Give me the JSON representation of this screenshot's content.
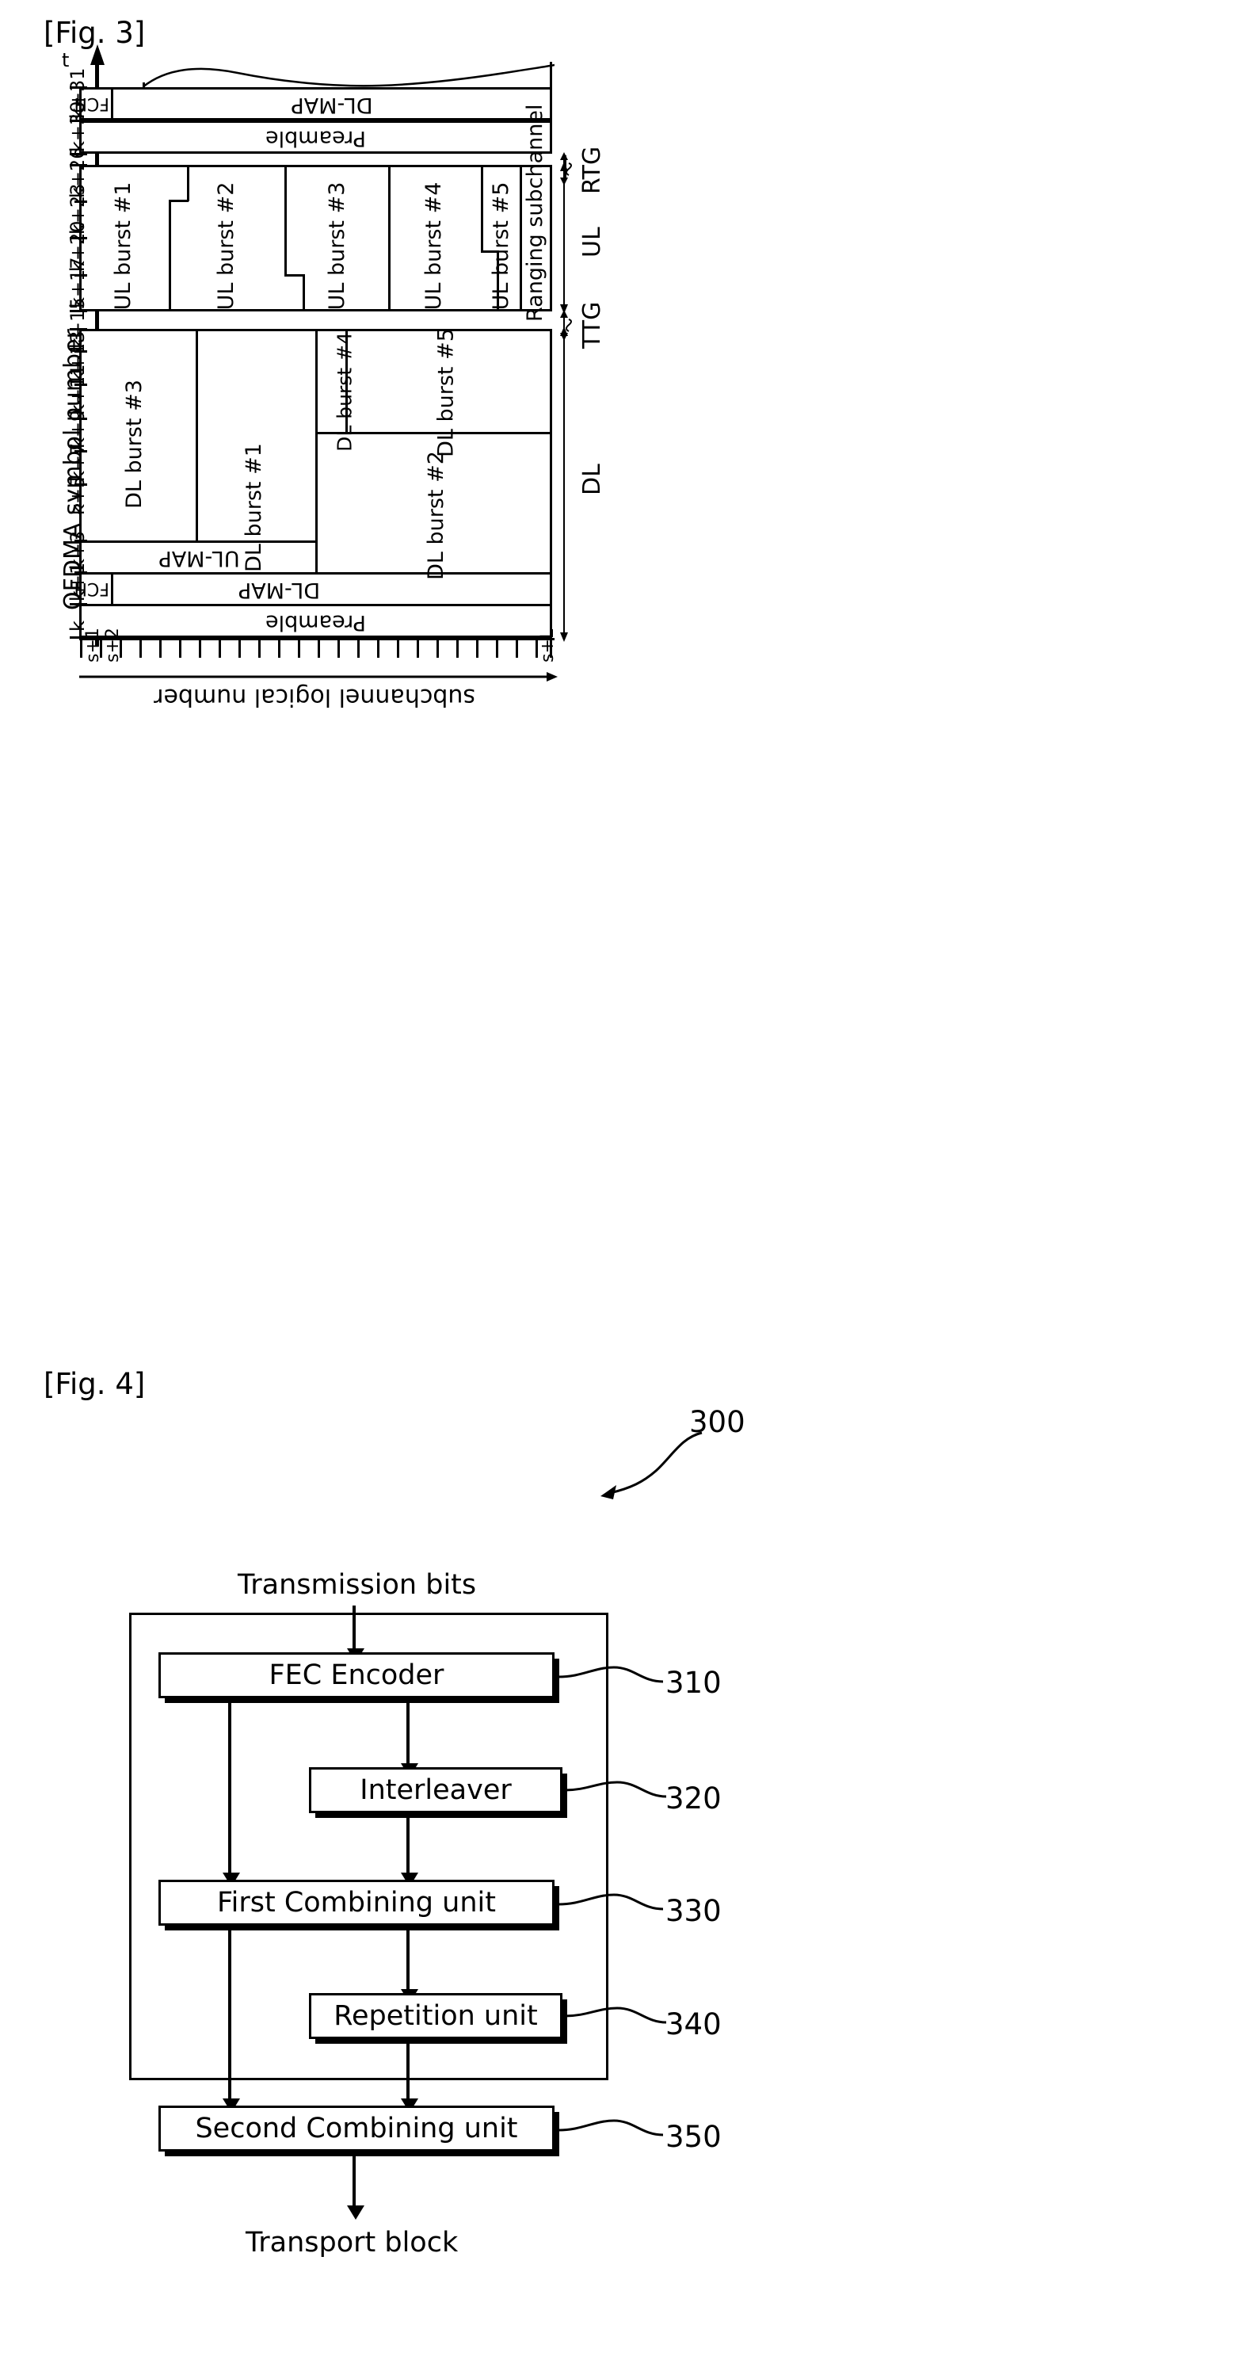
{
  "figures": {
    "fig3": {
      "label": "[Fig. 3]",
      "time_axis_label": "t",
      "y_axis_title": "OFDMA symbol number",
      "x_axis_title": "subchannel logical number",
      "y_ticks": [
        "k+31",
        "k+30",
        "k+26",
        "k+23",
        "k+20",
        "k+17",
        "k+15",
        "k+13",
        "k+11",
        "k+9",
        "k+7",
        "k+5",
        "k+3",
        "k+1",
        "k"
      ],
      "x_ticks": [
        "s+1",
        "s+2",
        "s+L"
      ],
      "side_labels": {
        "rtg": "RTG",
        "ttg": "TTG",
        "ul": "UL",
        "dl": "DL"
      },
      "next_frame": {
        "fch": "FCH",
        "dl_map": "DL-MAP",
        "preamble": "Preamble"
      },
      "ul_subframe": {
        "bursts": [
          "UL burst #1",
          "UL burst #2",
          "UL burst #3",
          "UL burst #4",
          "UL burst #5"
        ],
        "ranging": "Ranging subchannel"
      },
      "dl_subframe": {
        "preamble": "Preamble",
        "fch": "FCH",
        "dl_map": "DL-MAP",
        "ul_map": "UL-MAP",
        "bursts": [
          "DL burst #1",
          "DL burst #2",
          "DL burst #3",
          "DL burst #4",
          "DL burst #5"
        ]
      }
    },
    "fig4": {
      "label": "[Fig. 4]",
      "system_ref": "300",
      "input_label": "Transmission bits",
      "output_label": "Transport block",
      "blocks": [
        {
          "name": "FEC Encoder",
          "ref": "310"
        },
        {
          "name": "Interleaver",
          "ref": "320"
        },
        {
          "name": "First Combining unit",
          "ref": "330"
        },
        {
          "name": "Repetition unit",
          "ref": "340"
        },
        {
          "name": "Second Combining unit",
          "ref": "350"
        }
      ]
    }
  },
  "colors": {
    "ink": "#000000",
    "paper": "#ffffff"
  }
}
